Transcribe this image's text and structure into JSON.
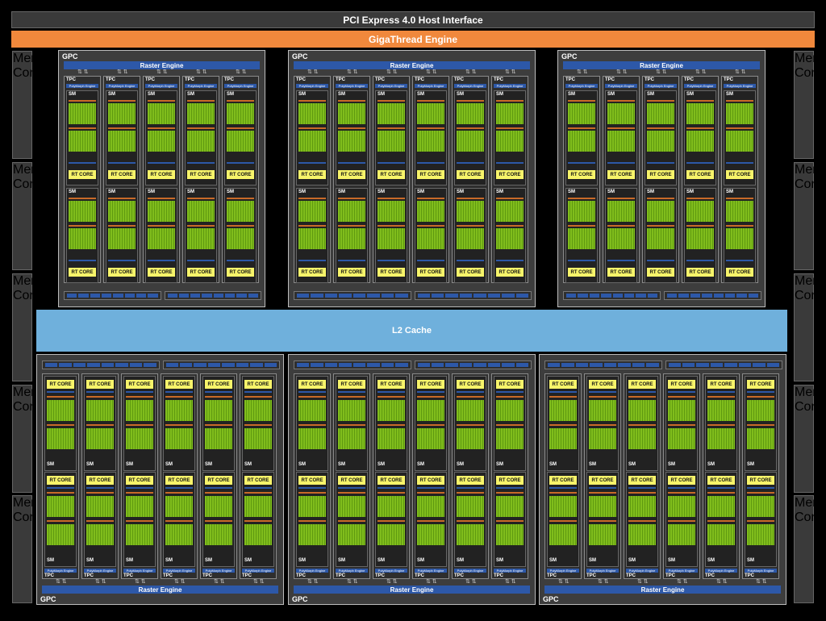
{
  "header": {
    "pcie": "PCI Express 4.0 Host Interface",
    "gigathread": "GigaThread Engine"
  },
  "l2_cache": "L2 Cache",
  "memory_controller_label": "Memory Controller",
  "gpc_label": "GPC",
  "raster_engine_label": "Raster Engine",
  "tpc_label": "TPC",
  "polymorph_label": "PolyMorph Engine",
  "sm_label": "SM",
  "rt_core_label": "RT CORE",
  "layout": {
    "tpcs_per_gpc": 6,
    "gpc_count": 6,
    "memory_controllers_per_side": 5
  },
  "colors": {
    "gigathread": "#f0883c",
    "l2": "#6fb0dc",
    "raster": "#2d58a8",
    "cuda_cores": "#80bd1c",
    "rt_core": "#f7f46a"
  }
}
